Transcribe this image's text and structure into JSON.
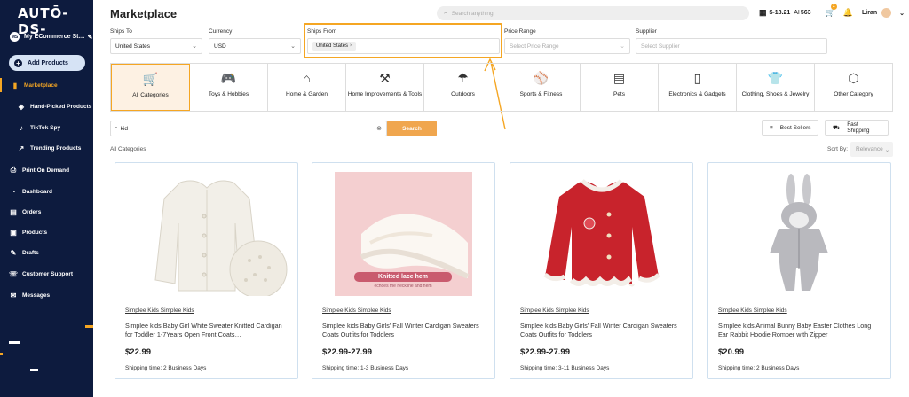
{
  "sidebar": {
    "logo": "AUTŌ-DS-",
    "store_badge": "MS",
    "store_name": "My ECommerce St…",
    "add_products": "Add Products",
    "items": [
      {
        "label": "Marketplace",
        "icon": "marketplace-icon",
        "active": true
      },
      {
        "label": "Hand-Picked Products",
        "icon": "handpicked-icon"
      },
      {
        "label": "TikTok Spy",
        "icon": "tiktok-icon"
      },
      {
        "label": "Trending Products",
        "icon": "trending-icon"
      },
      {
        "label": "Print On Demand",
        "icon": "print-icon"
      },
      {
        "label": "Dashboard",
        "icon": "dashboard-icon"
      },
      {
        "label": "Orders",
        "icon": "orders-icon"
      },
      {
        "label": "Products",
        "icon": "products-icon"
      },
      {
        "label": "Drafts",
        "icon": "drafts-icon"
      },
      {
        "label": "Customer Support",
        "icon": "support-icon"
      },
      {
        "label": "Messages",
        "icon": "messages-icon"
      }
    ]
  },
  "header": {
    "title": "Marketplace",
    "search_placeholder": "Search anything",
    "balance": "$-18.21",
    "ai_label": "AI",
    "ai_credits": "563",
    "cart_count": "1",
    "user_name": "Liran"
  },
  "filters": {
    "ships_to": {
      "label": "Ships To",
      "value": "United States"
    },
    "currency": {
      "label": "Currency",
      "value": "USD"
    },
    "ships_from": {
      "label": "Ships From",
      "chip": "United States"
    },
    "price_range": {
      "label": "Price Range",
      "placeholder": "Select Price Range"
    },
    "supplier": {
      "label": "Supplier",
      "placeholder": "Select Supplier"
    }
  },
  "categories": [
    {
      "label": "All Categories",
      "icon": "cart-icon",
      "glyph": "🛒",
      "selected": true
    },
    {
      "label": "Toys & Hobbies",
      "icon": "gamepad-icon",
      "glyph": "🎮"
    },
    {
      "label": "Home & Garden",
      "icon": "house-icon",
      "glyph": "⌂"
    },
    {
      "label": "Home Improvements & Tools",
      "icon": "tools-icon",
      "glyph": "⚒"
    },
    {
      "label": "Outdoors",
      "icon": "umbrella-icon",
      "glyph": "☂"
    },
    {
      "label": "Sports & Fitness",
      "icon": "ball-icon",
      "glyph": "⚾"
    },
    {
      "label": "Pets",
      "icon": "pet-food-icon",
      "glyph": "▤"
    },
    {
      "label": "Electronics & Gadgets",
      "icon": "phone-icon",
      "glyph": "▯"
    },
    {
      "label": "Clothing, Shoes & Jewelry",
      "icon": "shirt-icon",
      "glyph": "👕"
    },
    {
      "label": "Other Category",
      "icon": "box-icon",
      "glyph": "⬡"
    }
  ],
  "search": {
    "query": "kid",
    "button": "Search",
    "best_sellers": "Best Sellers",
    "fast_shipping": "Fast Shipping"
  },
  "listing": {
    "breadcrumb": "All Categories",
    "sort_label": "Sort By:",
    "sort_value": "Relevance"
  },
  "products": [
    {
      "vendor": "Simplee Kids Simplee Kids",
      "name": "Simplee kids Baby Girl White Sweater Knitted Cardigan for Toddler 1-7Years Open Front Coats…",
      "price": "$22.99",
      "shipping": "Shipping time: 2 Business Days"
    },
    {
      "vendor": "Simplee Kids Simplee Kids",
      "name": "Simplee kids Baby Girls' Fall Winter Cardigan Sweaters Coats Outfits for Toddlers",
      "price": "$22.99-27.99",
      "shipping": "Shipping time: 1-3 Business Days",
      "overlay_title": "Knitted lace hem",
      "overlay_sub": "echoes the neckline and hem"
    },
    {
      "vendor": "Simplee Kids Simplee Kids",
      "name": "Simplee kids Baby Girls' Fall Winter Cardigan Sweaters Coats Outfits for Toddlers",
      "price": "$22.99-27.99",
      "shipping": "Shipping time: 3-11 Business Days"
    },
    {
      "vendor": "Simplee Kids Simplee Kids",
      "name": "Simplee kids Animal Bunny Baby Easter Clothes Long Ear Rabbit Hoodie Romper with Zipper",
      "price": "$20.99",
      "shipping": "Shipping time: 2 Business Days"
    }
  ],
  "colors": {
    "accent": "#f5a623",
    "sidebar": "#0d1b3e",
    "search_btn": "#f0a64e"
  }
}
